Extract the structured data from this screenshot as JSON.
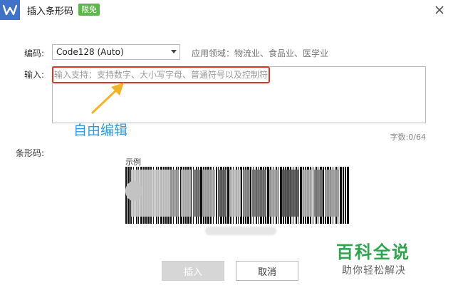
{
  "title": {
    "text": "插入条形码",
    "badge": "限免",
    "logo_icon": "wps-logo-icon",
    "close_icon": "close-icon"
  },
  "encoding": {
    "label": "编码:",
    "selected": "Code128 (Auto)",
    "hint": "应用领域：物流业、食品业、医学业"
  },
  "input": {
    "label": "输入:",
    "placeholder": "输入支持：支持数字、大小写字母、普通符号以及控制符",
    "annotation": "自由编辑",
    "char_count": "字数:0/64"
  },
  "barcode": {
    "label": "条形码:",
    "sample_label": "示例"
  },
  "buttons": {
    "insert": "插入",
    "cancel": "取消"
  },
  "watermark": {
    "title": "百科全说",
    "subtitle": "助你轻松解决"
  },
  "colors": {
    "accent": "#3f72c9",
    "badge": "#5db64a",
    "highlight": "#d9352c",
    "annotation": "#2f9be0",
    "watermark": "#2fa34d"
  }
}
